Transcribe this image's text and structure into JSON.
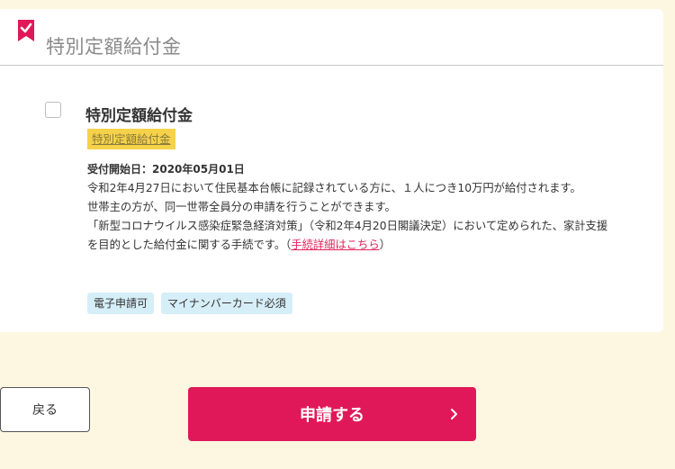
{
  "card": {
    "header_title": "特別定額給付金"
  },
  "item": {
    "title": "特別定額給付金",
    "tag": "特別定額給付金",
    "date_label": "受付開始日：2020年05月01日",
    "desc1": "令和2年4月27日において住民基本台帳に記録されている方に、１人につき10万円が給付されます。",
    "desc2": "世帯主の方が、同一世帯全員分の申請を行うことができます。",
    "desc3": "「新型コロナウイルス感染症緊急経済対策」（令和2年4月20日閣議決定）において定められた、家計支援を目的とした給付金に関する手続です。（",
    "link_text": "手続詳細はこちら",
    "desc3_end": "）"
  },
  "badges": [
    "電子申請可",
    "マイナンバーカード必須"
  ],
  "buttons": {
    "back_label": "戻る",
    "apply_label": "申請する"
  },
  "colors": {
    "accent": "#e0185a",
    "background": "#fdf6e1",
    "tag_yellow": "#f5d24a",
    "badge_blue": "#d6eef8"
  }
}
